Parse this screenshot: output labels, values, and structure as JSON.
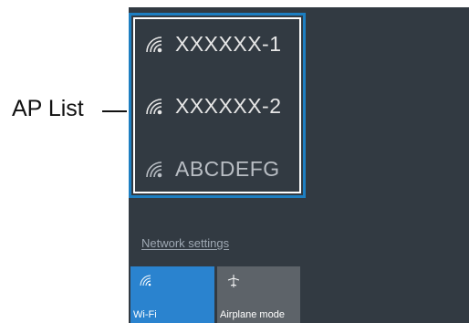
{
  "callout": {
    "label": "AP List"
  },
  "ap_list": [
    {
      "ssid": "XXXXXX-1",
      "icon": "wifi-signal-icon"
    },
    {
      "ssid": "XXXXXX-2",
      "icon": "wifi-signal-icon"
    },
    {
      "ssid": "ABCDEFG",
      "icon": "wifi-signal-icon"
    }
  ],
  "network_settings_label": "Network settings",
  "quick_actions": [
    {
      "label": "Wi-Fi",
      "icon": "wifi-icon",
      "state": "on"
    },
    {
      "label": "Airplane mode",
      "icon": "airplane-icon",
      "state": "off"
    }
  ],
  "colors": {
    "flyout_bg": "#323a42",
    "highlight_border": "#1d7fc2",
    "wifi_tile": "#2a83cf",
    "airplane_tile": "#5d6369"
  }
}
